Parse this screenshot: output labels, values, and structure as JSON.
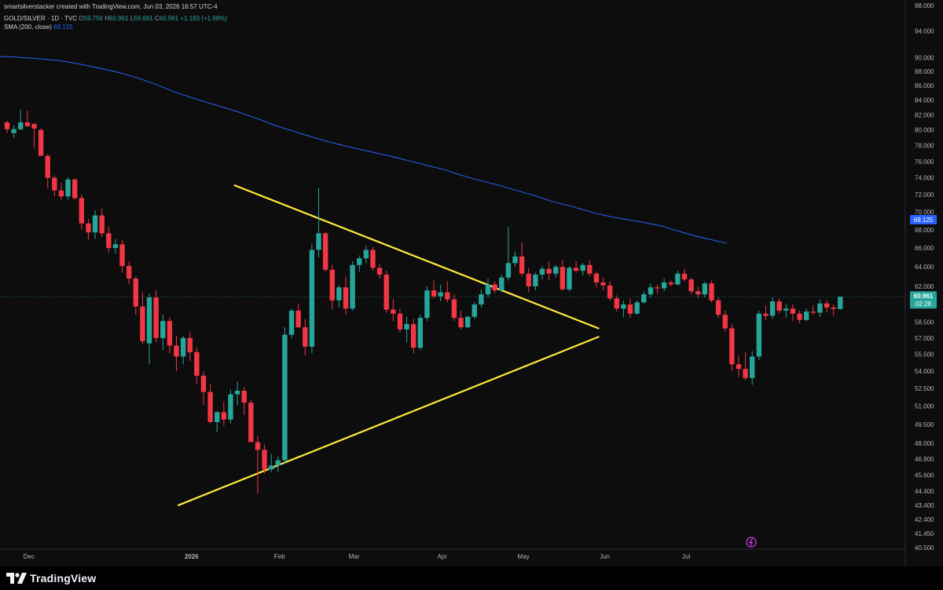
{
  "header": {
    "attribution": "smartsilverstacker created with TradingView.com, Jun 03, 2026 16:57 UTC-4",
    "symbol": "GOLD/SILVER · 1D · TVC",
    "o_label": "O",
    "o_value": "59.756",
    "h_label": "H",
    "h_value": "60.961",
    "l_label": "L",
    "l_value": "59.691",
    "c_label": "C",
    "c_value": "60.961",
    "change": "+1.183 (+1.98%)",
    "sma_label": "SMA (200, close)",
    "sma_value": "69.125"
  },
  "footer": {
    "brand": "TradingView"
  },
  "chart_data": {
    "type": "candlestick",
    "symbol": "GOLD/SILVER",
    "interval": "1D",
    "x_tick_labels": [
      "Dec",
      "2026",
      "Feb",
      "Mar",
      "Apr",
      "May",
      "Jun",
      "Jul"
    ],
    "y_tick_labels": [
      "98.000",
      "94.000",
      "90.000",
      "88.000",
      "86.000",
      "84.000",
      "82.000",
      "80.000",
      "78.000",
      "76.000",
      "74.000",
      "72.000",
      "70.000",
      "68.000",
      "66.000",
      "64.000",
      "62.000",
      "58.500",
      "57.000",
      "55.500",
      "54.000",
      "52.500",
      "51.000",
      "49.500",
      "48.000",
      "46.800",
      "45.600",
      "44.400",
      "43.400",
      "42.400",
      "41.450",
      "40.500"
    ],
    "y_scale": "log",
    "y_range": [
      40.5,
      98.0
    ],
    "price_label": {
      "value": "60.961",
      "countdown": "02:28",
      "color": "#26a69a"
    },
    "sma_label": {
      "value": "69.125",
      "color": "#2962ff"
    },
    "colors": {
      "up": "#26a69a",
      "down": "#f23645",
      "sma": "#2962ff",
      "trendline": "#ffeb3b",
      "background": "#0d0d0d"
    },
    "ohlc": [
      [
        81.0,
        81.2,
        79.6,
        80.1
      ],
      [
        79.6,
        80.6,
        79.0,
        80.1
      ],
      [
        80.1,
        82.7,
        80.0,
        81.0
      ],
      [
        81.0,
        82.6,
        80.4,
        80.5
      ],
      [
        80.8,
        80.9,
        77.6,
        80.2
      ],
      [
        80.0,
        80.2,
        77.4,
        76.7
      ],
      [
        76.7,
        76.9,
        72.8,
        74.0
      ],
      [
        74.0,
        74.3,
        71.8,
        72.5
      ],
      [
        72.5,
        73.4,
        71.4,
        71.8
      ],
      [
        71.8,
        74.1,
        71.4,
        73.8
      ],
      [
        73.8,
        73.9,
        71.4,
        71.6
      ],
      [
        71.6,
        72.0,
        68.0,
        68.7
      ],
      [
        68.7,
        69.2,
        66.9,
        67.7
      ],
      [
        67.7,
        70.2,
        67.0,
        69.6
      ],
      [
        69.6,
        70.4,
        67.2,
        67.6
      ],
      [
        67.6,
        68.3,
        65.5,
        66.0
      ],
      [
        66.0,
        67.0,
        65.4,
        66.4
      ],
      [
        66.4,
        66.9,
        63.4,
        64.1
      ],
      [
        64.1,
        64.6,
        62.2,
        62.8
      ],
      [
        62.8,
        63.0,
        59.2,
        60.0
      ],
      [
        60.0,
        61.4,
        56.4,
        56.7
      ],
      [
        56.5,
        61.3,
        54.6,
        60.9
      ],
      [
        60.9,
        61.6,
        56.6,
        57.0
      ],
      [
        57.0,
        59.2,
        55.9,
        58.6
      ],
      [
        58.6,
        59.0,
        55.6,
        56.3
      ],
      [
        56.3,
        57.2,
        54.0,
        55.3
      ],
      [
        55.3,
        57.2,
        54.6,
        57.0
      ],
      [
        57.0,
        57.6,
        54.9,
        55.7
      ],
      [
        55.7,
        56.1,
        52.9,
        53.6
      ],
      [
        53.6,
        54.0,
        51.1,
        52.2
      ],
      [
        52.2,
        52.9,
        49.6,
        49.7
      ],
      [
        49.7,
        50.6,
        48.9,
        50.5
      ],
      [
        50.5,
        51.4,
        49.4,
        49.9
      ],
      [
        49.9,
        52.4,
        49.6,
        52.0
      ],
      [
        52.0,
        53.1,
        51.1,
        52.3
      ],
      [
        52.3,
        52.6,
        50.3,
        51.3
      ],
      [
        51.3,
        51.5,
        48.1,
        48.1
      ],
      [
        48.1,
        48.6,
        44.2,
        47.5
      ],
      [
        47.5,
        47.9,
        45.7,
        46.0
      ],
      [
        46.0,
        47.2,
        45.8,
        46.3
      ],
      [
        46.3,
        47.0,
        45.8,
        46.7
      ],
      [
        46.7,
        58.0,
        46.4,
        57.3
      ],
      [
        57.3,
        59.8,
        57.0,
        59.6
      ],
      [
        59.6,
        60.3,
        57.9,
        58.0
      ],
      [
        58.0,
        58.8,
        55.4,
        56.2
      ],
      [
        56.2,
        66.5,
        55.6,
        65.8
      ],
      [
        65.8,
        72.8,
        65.0,
        67.6
      ],
      [
        67.6,
        67.8,
        63.5,
        63.7
      ],
      [
        63.7,
        64.2,
        59.7,
        60.6
      ],
      [
        60.6,
        62.1,
        59.9,
        61.9
      ],
      [
        61.9,
        63.0,
        59.2,
        59.8
      ],
      [
        59.8,
        64.6,
        59.6,
        64.2
      ],
      [
        64.2,
        65.2,
        63.5,
        64.9
      ],
      [
        64.9,
        66.3,
        64.4,
        65.8
      ],
      [
        65.8,
        66.1,
        63.6,
        63.9
      ],
      [
        63.9,
        64.3,
        62.8,
        63.2
      ],
      [
        63.2,
        63.6,
        59.4,
        59.7
      ],
      [
        59.7,
        60.7,
        58.6,
        59.3
      ],
      [
        59.3,
        59.8,
        57.5,
        57.8
      ],
      [
        57.8,
        59.0,
        56.6,
        58.3
      ],
      [
        58.3,
        58.8,
        55.6,
        56.1
      ],
      [
        56.1,
        59.2,
        55.9,
        58.9
      ],
      [
        58.9,
        62.0,
        58.6,
        61.6
      ],
      [
        61.6,
        62.6,
        60.8,
        61.0
      ],
      [
        61.0,
        62.2,
        60.5,
        61.4
      ],
      [
        61.4,
        62.5,
        60.4,
        60.7
      ],
      [
        60.7,
        61.2,
        58.6,
        58.9
      ],
      [
        58.9,
        59.6,
        57.8,
        58.0
      ],
      [
        58.0,
        59.1,
        57.9,
        59.0
      ],
      [
        59.0,
        60.4,
        58.8,
        60.2
      ],
      [
        60.2,
        61.7,
        59.9,
        61.2
      ],
      [
        61.2,
        62.8,
        60.9,
        62.2
      ],
      [
        62.2,
        62.5,
        61.3,
        61.6
      ],
      [
        61.6,
        63.2,
        61.4,
        62.9
      ],
      [
        62.9,
        68.3,
        62.6,
        64.4
      ],
      [
        64.4,
        65.6,
        64.0,
        65.1
      ],
      [
        65.1,
        66.6,
        63.0,
        63.3
      ],
      [
        63.3,
        63.9,
        61.4,
        62.0
      ],
      [
        62.0,
        63.4,
        61.6,
        63.2
      ],
      [
        63.2,
        64.1,
        62.7,
        63.8
      ],
      [
        63.8,
        64.6,
        62.6,
        63.3
      ],
      [
        63.3,
        64.2,
        62.9,
        64.0
      ],
      [
        64.0,
        64.7,
        61.6,
        61.7
      ],
      [
        61.7,
        64.1,
        61.5,
        63.9
      ],
      [
        63.9,
        64.6,
        63.4,
        63.6
      ],
      [
        63.6,
        64.4,
        63.1,
        64.2
      ],
      [
        64.2,
        64.7,
        63.0,
        63.3
      ],
      [
        63.3,
        63.5,
        61.9,
        62.4
      ],
      [
        62.4,
        62.9,
        61.6,
        62.1
      ],
      [
        62.1,
        62.5,
        60.6,
        60.8
      ],
      [
        60.8,
        61.1,
        59.5,
        59.8
      ],
      [
        59.8,
        60.6,
        59.0,
        60.2
      ],
      [
        60.2,
        60.8,
        58.9,
        59.3
      ],
      [
        59.3,
        60.6,
        59.2,
        60.4
      ],
      [
        60.4,
        61.5,
        60.3,
        61.2
      ],
      [
        61.2,
        62.3,
        60.9,
        61.9
      ],
      [
        61.9,
        62.2,
        61.3,
        61.8
      ],
      [
        61.8,
        62.8,
        61.5,
        62.4
      ],
      [
        62.4,
        62.6,
        62.0,
        62.2
      ],
      [
        62.2,
        63.6,
        62.1,
        63.3
      ],
      [
        63.3,
        63.8,
        62.5,
        62.7
      ],
      [
        62.7,
        62.9,
        61.2,
        61.5
      ],
      [
        61.5,
        62.0,
        60.8,
        61.2
      ],
      [
        61.2,
        62.5,
        60.9,
        62.3
      ],
      [
        62.3,
        62.6,
        60.4,
        60.6
      ],
      [
        60.6,
        60.9,
        58.9,
        59.2
      ],
      [
        59.2,
        59.6,
        57.6,
        57.9
      ],
      [
        57.9,
        58.3,
        54.0,
        54.6
      ],
      [
        54.6,
        55.4,
        53.5,
        54.2
      ],
      [
        54.2,
        55.7,
        53.2,
        53.4
      ],
      [
        53.4,
        55.8,
        52.8,
        55.3
      ],
      [
        55.3,
        59.6,
        55.0,
        59.3
      ],
      [
        59.3,
        60.1,
        58.7,
        59.1
      ],
      [
        59.1,
        60.9,
        58.8,
        60.5
      ],
      [
        60.5,
        60.8,
        59.3,
        59.6
      ],
      [
        59.6,
        60.3,
        58.9,
        59.8
      ],
      [
        59.8,
        60.2,
        58.6,
        59.3
      ],
      [
        59.3,
        59.6,
        58.4,
        58.7
      ],
      [
        58.7,
        59.8,
        58.6,
        59.5
      ],
      [
        59.5,
        60.1,
        59.2,
        59.4
      ],
      [
        59.4,
        60.7,
        59.0,
        60.3
      ],
      [
        60.3,
        60.6,
        59.4,
        59.9
      ],
      [
        59.9,
        60.2,
        59.1,
        59.76
      ],
      [
        59.76,
        60.961,
        59.691,
        60.961
      ]
    ],
    "sma": [
      [
        0,
        90.2
      ],
      [
        8,
        90.1
      ],
      [
        18,
        89.9
      ],
      [
        30,
        89.6
      ],
      [
        40,
        89.1
      ],
      [
        52,
        88.4
      ],
      [
        60,
        87.9
      ],
      [
        70,
        87.1
      ],
      [
        80,
        86.1
      ],
      [
        90,
        85.0
      ],
      [
        105,
        83.7
      ],
      [
        120,
        82.5
      ],
      [
        130,
        81.6
      ],
      [
        140,
        80.6
      ],
      [
        150,
        79.8
      ],
      [
        160,
        79.0
      ],
      [
        170,
        78.3
      ],
      [
        180,
        77.7
      ],
      [
        189,
        77.2
      ],
      [
        198,
        76.7
      ],
      [
        208,
        76.1
      ],
      [
        216,
        75.6
      ],
      [
        226,
        75.0
      ],
      [
        235,
        74.3
      ],
      [
        244,
        73.7
      ],
      [
        254,
        73.1
      ],
      [
        263,
        72.5
      ],
      [
        272,
        71.9
      ],
      [
        281,
        71.2
      ],
      [
        290,
        70.7
      ],
      [
        299,
        70.1
      ],
      [
        304,
        69.8
      ],
      [
        312,
        69.4
      ],
      [
        320,
        69.1
      ],
      [
        328,
        68.8
      ],
      [
        337,
        68.4
      ],
      [
        346,
        67.8
      ],
      [
        354,
        67.3
      ],
      [
        362,
        66.9
      ],
      [
        370,
        66.5
      ]
    ],
    "trendlines": [
      {
        "name": "upper",
        "points": [
          [
            33.6,
            73.1
          ],
          [
            87.3,
            57.9
          ]
        ]
      },
      {
        "name": "lower",
        "points": [
          [
            25.3,
            43.4
          ],
          [
            87.3,
            57.1
          ]
        ]
      }
    ],
    "x_axis_ticks": [
      [
        3,
        "Dec"
      ],
      [
        27,
        "2026"
      ],
      [
        40,
        "Feb"
      ],
      [
        51,
        "Mar"
      ],
      [
        64,
        "Apr"
      ],
      [
        76,
        "May"
      ],
      [
        88,
        "Jun"
      ],
      [
        100,
        "Jul"
      ]
    ]
  }
}
